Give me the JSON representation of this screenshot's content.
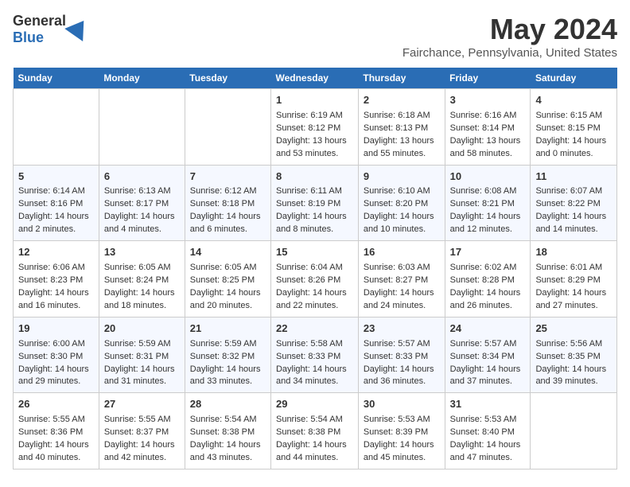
{
  "header": {
    "logo_general": "General",
    "logo_blue": "Blue",
    "month_title": "May 2024",
    "location": "Fairchance, Pennsylvania, United States"
  },
  "days_of_week": [
    "Sunday",
    "Monday",
    "Tuesday",
    "Wednesday",
    "Thursday",
    "Friday",
    "Saturday"
  ],
  "weeks": [
    [
      {
        "day": "",
        "info": ""
      },
      {
        "day": "",
        "info": ""
      },
      {
        "day": "",
        "info": ""
      },
      {
        "day": "1",
        "info": "Sunrise: 6:19 AM\nSunset: 8:12 PM\nDaylight: 13 hours and 53 minutes."
      },
      {
        "day": "2",
        "info": "Sunrise: 6:18 AM\nSunset: 8:13 PM\nDaylight: 13 hours and 55 minutes."
      },
      {
        "day": "3",
        "info": "Sunrise: 6:16 AM\nSunset: 8:14 PM\nDaylight: 13 hours and 58 minutes."
      },
      {
        "day": "4",
        "info": "Sunrise: 6:15 AM\nSunset: 8:15 PM\nDaylight: 14 hours and 0 minutes."
      }
    ],
    [
      {
        "day": "5",
        "info": "Sunrise: 6:14 AM\nSunset: 8:16 PM\nDaylight: 14 hours and 2 minutes."
      },
      {
        "day": "6",
        "info": "Sunrise: 6:13 AM\nSunset: 8:17 PM\nDaylight: 14 hours and 4 minutes."
      },
      {
        "day": "7",
        "info": "Sunrise: 6:12 AM\nSunset: 8:18 PM\nDaylight: 14 hours and 6 minutes."
      },
      {
        "day": "8",
        "info": "Sunrise: 6:11 AM\nSunset: 8:19 PM\nDaylight: 14 hours and 8 minutes."
      },
      {
        "day": "9",
        "info": "Sunrise: 6:10 AM\nSunset: 8:20 PM\nDaylight: 14 hours and 10 minutes."
      },
      {
        "day": "10",
        "info": "Sunrise: 6:08 AM\nSunset: 8:21 PM\nDaylight: 14 hours and 12 minutes."
      },
      {
        "day": "11",
        "info": "Sunrise: 6:07 AM\nSunset: 8:22 PM\nDaylight: 14 hours and 14 minutes."
      }
    ],
    [
      {
        "day": "12",
        "info": "Sunrise: 6:06 AM\nSunset: 8:23 PM\nDaylight: 14 hours and 16 minutes."
      },
      {
        "day": "13",
        "info": "Sunrise: 6:05 AM\nSunset: 8:24 PM\nDaylight: 14 hours and 18 minutes."
      },
      {
        "day": "14",
        "info": "Sunrise: 6:05 AM\nSunset: 8:25 PM\nDaylight: 14 hours and 20 minutes."
      },
      {
        "day": "15",
        "info": "Sunrise: 6:04 AM\nSunset: 8:26 PM\nDaylight: 14 hours and 22 minutes."
      },
      {
        "day": "16",
        "info": "Sunrise: 6:03 AM\nSunset: 8:27 PM\nDaylight: 14 hours and 24 minutes."
      },
      {
        "day": "17",
        "info": "Sunrise: 6:02 AM\nSunset: 8:28 PM\nDaylight: 14 hours and 26 minutes."
      },
      {
        "day": "18",
        "info": "Sunrise: 6:01 AM\nSunset: 8:29 PM\nDaylight: 14 hours and 27 minutes."
      }
    ],
    [
      {
        "day": "19",
        "info": "Sunrise: 6:00 AM\nSunset: 8:30 PM\nDaylight: 14 hours and 29 minutes."
      },
      {
        "day": "20",
        "info": "Sunrise: 5:59 AM\nSunset: 8:31 PM\nDaylight: 14 hours and 31 minutes."
      },
      {
        "day": "21",
        "info": "Sunrise: 5:59 AM\nSunset: 8:32 PM\nDaylight: 14 hours and 33 minutes."
      },
      {
        "day": "22",
        "info": "Sunrise: 5:58 AM\nSunset: 8:33 PM\nDaylight: 14 hours and 34 minutes."
      },
      {
        "day": "23",
        "info": "Sunrise: 5:57 AM\nSunset: 8:33 PM\nDaylight: 14 hours and 36 minutes."
      },
      {
        "day": "24",
        "info": "Sunrise: 5:57 AM\nSunset: 8:34 PM\nDaylight: 14 hours and 37 minutes."
      },
      {
        "day": "25",
        "info": "Sunrise: 5:56 AM\nSunset: 8:35 PM\nDaylight: 14 hours and 39 minutes."
      }
    ],
    [
      {
        "day": "26",
        "info": "Sunrise: 5:55 AM\nSunset: 8:36 PM\nDaylight: 14 hours and 40 minutes."
      },
      {
        "day": "27",
        "info": "Sunrise: 5:55 AM\nSunset: 8:37 PM\nDaylight: 14 hours and 42 minutes."
      },
      {
        "day": "28",
        "info": "Sunrise: 5:54 AM\nSunset: 8:38 PM\nDaylight: 14 hours and 43 minutes."
      },
      {
        "day": "29",
        "info": "Sunrise: 5:54 AM\nSunset: 8:38 PM\nDaylight: 14 hours and 44 minutes."
      },
      {
        "day": "30",
        "info": "Sunrise: 5:53 AM\nSunset: 8:39 PM\nDaylight: 14 hours and 45 minutes."
      },
      {
        "day": "31",
        "info": "Sunrise: 5:53 AM\nSunset: 8:40 PM\nDaylight: 14 hours and 47 minutes."
      },
      {
        "day": "",
        "info": ""
      }
    ]
  ]
}
